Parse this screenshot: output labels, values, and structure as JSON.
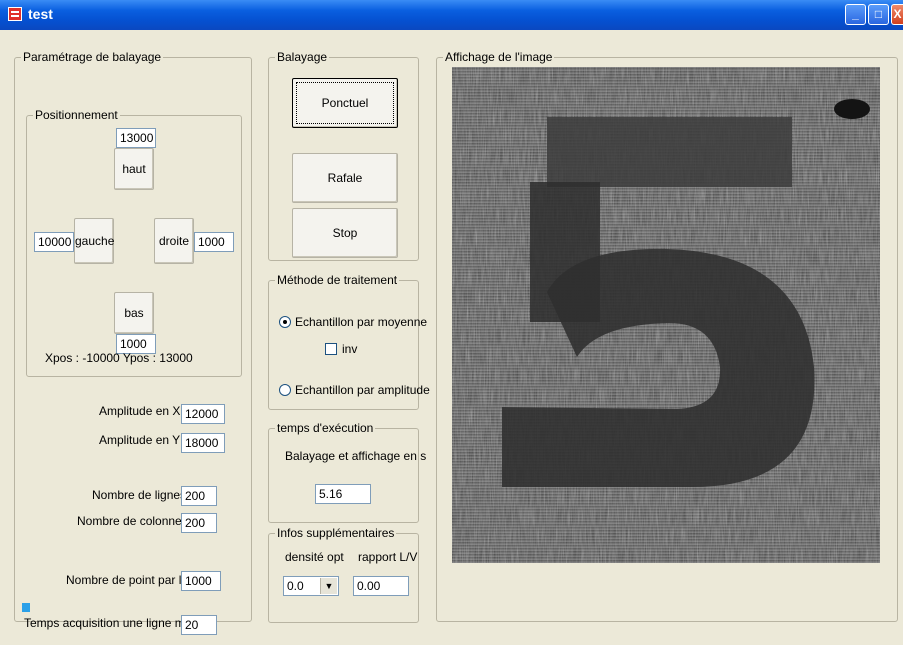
{
  "window": {
    "title": "test",
    "controls": [
      "minimize-icon",
      "maximize-icon",
      "close-icon"
    ],
    "title_gradient": "#0a5fe0"
  },
  "scan_params": {
    "group_label": "Paramétrage de balayage",
    "positioning": {
      "group_label": "Positionnement",
      "top_value": "13000",
      "up_label": "haut",
      "left_value": "10000",
      "left_label": "gauche",
      "right_label": "droite",
      "right_value": "1000",
      "down_label": "bas",
      "bottom_value": "1000",
      "status": "Xpos : -10000  Ypos : 13000"
    },
    "amplitude_x_label": "Amplitude en X",
    "amplitude_x_value": "12000",
    "amplitude_y_label": "Amplitude en Y",
    "amplitude_y_value": "18000",
    "lines_label": "Nombre de lignes",
    "lines_value": "200",
    "columns_label": "Nombre de colonnes",
    "columns_value": "200",
    "points_label": "Nombre de point par ligne",
    "points_value": "1000",
    "acq_label": "Temps acquisition une ligne ms",
    "acq_value": "20"
  },
  "scan": {
    "group_label": "Balayage",
    "ponctuel_label": "Ponctuel",
    "rafale_label": "Rafale",
    "stop_label": "Stop"
  },
  "method": {
    "group_label": "Méthode de traitement",
    "option_mean": "Echantillon par moyenne",
    "inv_label": "inv",
    "option_amplitude": "Echantillon par amplitude",
    "selected": "Echantillon par moyenne"
  },
  "exec_time": {
    "group_label": "temps d'exécution",
    "caption": "Balayage et affichage en s",
    "value": "5.16"
  },
  "extra": {
    "group_label": "Infos supplémentaires",
    "density_label": "densité opt",
    "ratio_label": "rapport L/V",
    "density_value": "0.0",
    "ratio_value": "0.00"
  },
  "display": {
    "group_label": "Affichage de l'image"
  },
  "status": {
    "progress_color": "#2ba0e8"
  }
}
